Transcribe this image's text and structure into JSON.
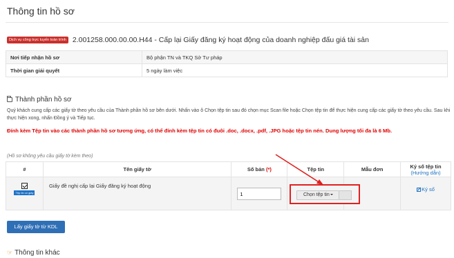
{
  "page": {
    "title": "Thông tin hồ sơ"
  },
  "service": {
    "badge": "Dịch vụ công trực tuyến toàn trình",
    "code_title": "2.001258.000.00.00.H44 - Cấp lại Giấy đăng ký hoạt động của doanh nghiệp đấu giá tài sản"
  },
  "info_rows": [
    {
      "label": "Nơi tiếp nhận hồ sơ",
      "value": "Bộ phận TN và TKQ Sở Tư pháp"
    },
    {
      "label": "Thời gian giải quyết",
      "value": "5 ngày làm việc"
    }
  ],
  "documents_section": {
    "heading": "Thành phần hồ sơ",
    "instructions": "Quý khách cung cấp các giấy tờ theo yêu cầu của Thành phần hồ sơ bên dưới. Nhấn vào ô Chọn tệp tin sau đó chọn mục Scan file hoặc Chọn tệp tin để thực hiện cung cấp các giấy tờ theo yêu cầu. Sau khi thực hiện xong, nhấn Đồng ý và Tiếp tục.",
    "warning": "Đính kèm Tệp tin vào các thành phần hồ sơ tương ứng, có thể đính kèm tệp tin có đuôi .doc, .docx, .pdf, .JPG hoặc tệp tin nén. Dung lượng tối đa là 6 Mb.",
    "note": "(Hồ sơ không yêu cầu giấy tờ kèm theo)"
  },
  "doc_table": {
    "headers": {
      "index": "#",
      "name": "Tên giấy tờ",
      "copies": "Số bản",
      "copies_required": "(*)",
      "file": "Tệp tin",
      "template": "Mẫu đơn",
      "sign": "Ký số tệp tin",
      "sign_guide": "(Hướng dẫn)"
    },
    "rows": [
      {
        "sample_badge": "Tệp tin có giấy",
        "name": "Giấy đề nghị cấp lại Giấy đăng ký hoạt động",
        "copies": "1",
        "file_button": "Chọn tệp tin",
        "sign_label": "Ký số"
      }
    ]
  },
  "actions": {
    "fetch_button": "Lấy giấy tờ từ KDL"
  },
  "other_section": {
    "heading": "Thông tin khác"
  },
  "colors": {
    "accent_blue": "#2f6fb6",
    "warning_red": "#e00000",
    "highlight_red": "#e02020"
  }
}
